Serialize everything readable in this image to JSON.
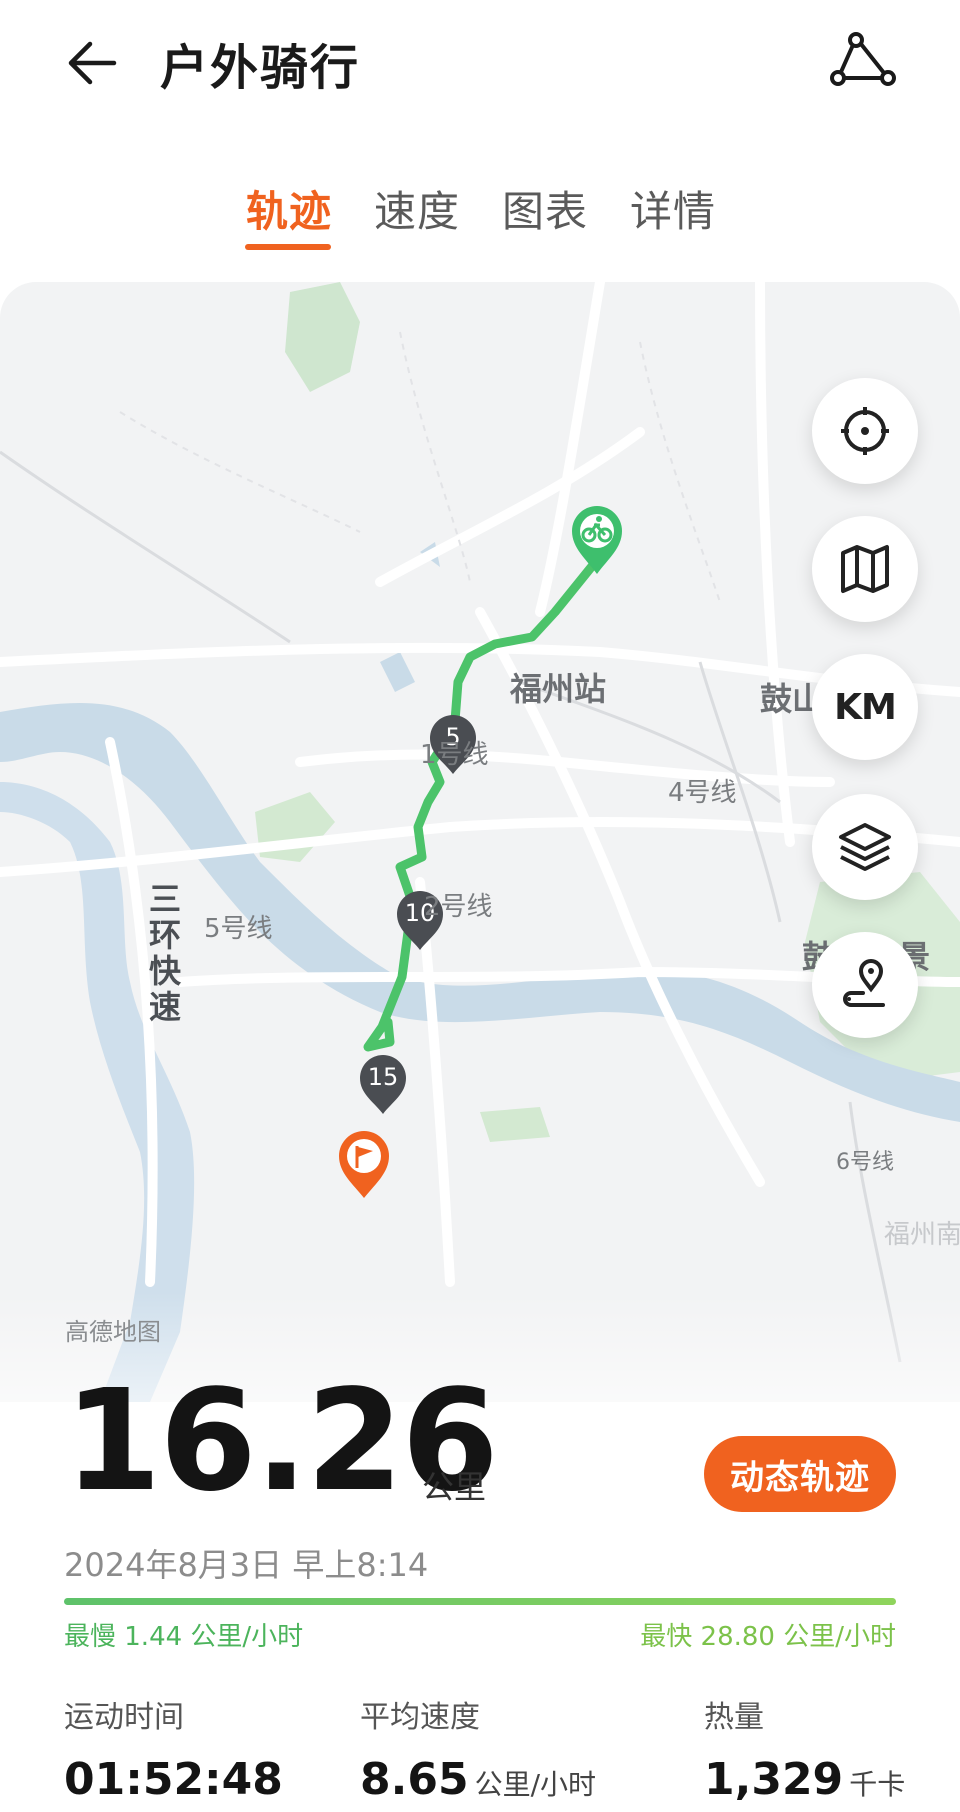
{
  "header": {
    "title": "户外骑行",
    "back_icon": "arrow-left-icon",
    "share_icon": "route-share-icon"
  },
  "tabs": [
    {
      "label": "轨迹",
      "active": true
    },
    {
      "label": "速度",
      "active": false
    },
    {
      "label": "图表",
      "active": false
    },
    {
      "label": "详情",
      "active": false
    }
  ],
  "map": {
    "labels": {
      "station": "福州站",
      "gu_top": "鼓山",
      "gushan_scenic": "鼓山风景",
      "line1": "1号线",
      "line2": "2号线",
      "line4": "4号线",
      "line5": "5号线",
      "line6": "6号线",
      "ring_road": "三环快速",
      "fuzhou_partial": "福州南"
    },
    "attribution": "高德地图",
    "km_markers": [
      "5",
      "10",
      "15"
    ],
    "controls": [
      "locate-icon",
      "map-icon",
      "KM",
      "layers-icon",
      "route-pin-icon"
    ],
    "km_label": "KM",
    "route_color": "#4cc36a",
    "start_color": "#3ebf6d",
    "end_color": "#f0621f"
  },
  "summary": {
    "distance": "16.26",
    "distance_unit": "公里",
    "dynamic_track_button": "动态轨迹",
    "date": "2024年8月3日 早上8:14",
    "slowest": "最慢 1.44 公里/小时",
    "fastest": "最快 28.80 公里/小时"
  },
  "metrics": [
    {
      "label": "运动时间",
      "value": "01:52:48",
      "unit": ""
    },
    {
      "label": "平均速度",
      "value": "8.65",
      "unit": "公里/小时"
    },
    {
      "label": "热量",
      "value": "1,329",
      "unit": "千卡"
    }
  ],
  "colors": {
    "accent": "#f0621f",
    "route": "#4cc36a"
  }
}
